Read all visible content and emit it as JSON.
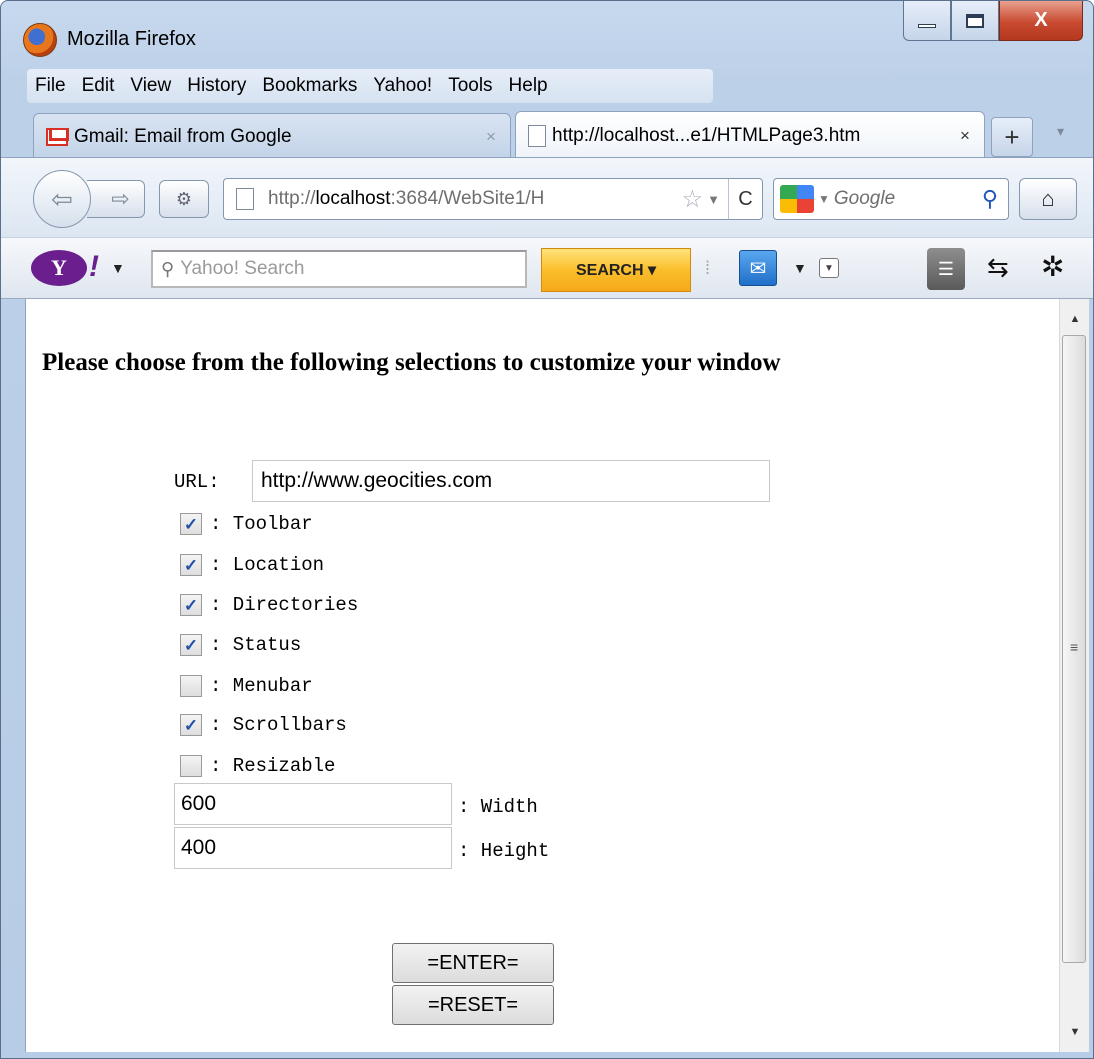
{
  "window": {
    "title": "Mozilla Firefox",
    "minimize_glyph": "",
    "maximize_glyph": "",
    "close_glyph": "X"
  },
  "menu": {
    "items": [
      "File",
      "Edit",
      "View",
      "History",
      "Bookmarks",
      "Yahoo!",
      "Tools",
      "Help"
    ]
  },
  "tabs": [
    {
      "label": "Gmail: Email from Google",
      "close": "×",
      "active": false,
      "icon": "gmail-icon"
    },
    {
      "label": "http://localhost...e1/HTMLPage3.htm",
      "close": "×",
      "active": true,
      "icon": "page-icon"
    }
  ],
  "tabs_controls": {
    "new_tab": "+",
    "list_all": "▾"
  },
  "navigation": {
    "back_glyph": "⇦",
    "forward_glyph": "⇨",
    "url_prefix": "http://",
    "url_host": "localhost",
    "url_rest": ":3684/WebSite1/H",
    "search_engine_placeholder": "Google",
    "reload_glyph": "C",
    "home_glyph": "⌂"
  },
  "yahoo_toolbar": {
    "logo": "Y",
    "exclamation": "!",
    "search_placeholder": "Yahoo! Search",
    "search_button": "SEARCH  ▾"
  },
  "page": {
    "heading": "Please choose from the following selections to customize your window",
    "url_label": "URL:",
    "url_value": "http://www.geocities.com",
    "options": [
      {
        "label": ": Toolbar",
        "checked": true
      },
      {
        "label": ": Location",
        "checked": true
      },
      {
        "label": ": Directories",
        "checked": true
      },
      {
        "label": ": Status",
        "checked": true
      },
      {
        "label": ": Menubar",
        "checked": false
      },
      {
        "label": ": Scrollbars",
        "checked": true
      },
      {
        "label": ": Resizable",
        "checked": false
      }
    ],
    "width_value": "600",
    "width_label": ": Width",
    "height_value": "400",
    "height_label": ": Height",
    "enter_button": "=ENTER=",
    "reset_button": "=RESET="
  }
}
